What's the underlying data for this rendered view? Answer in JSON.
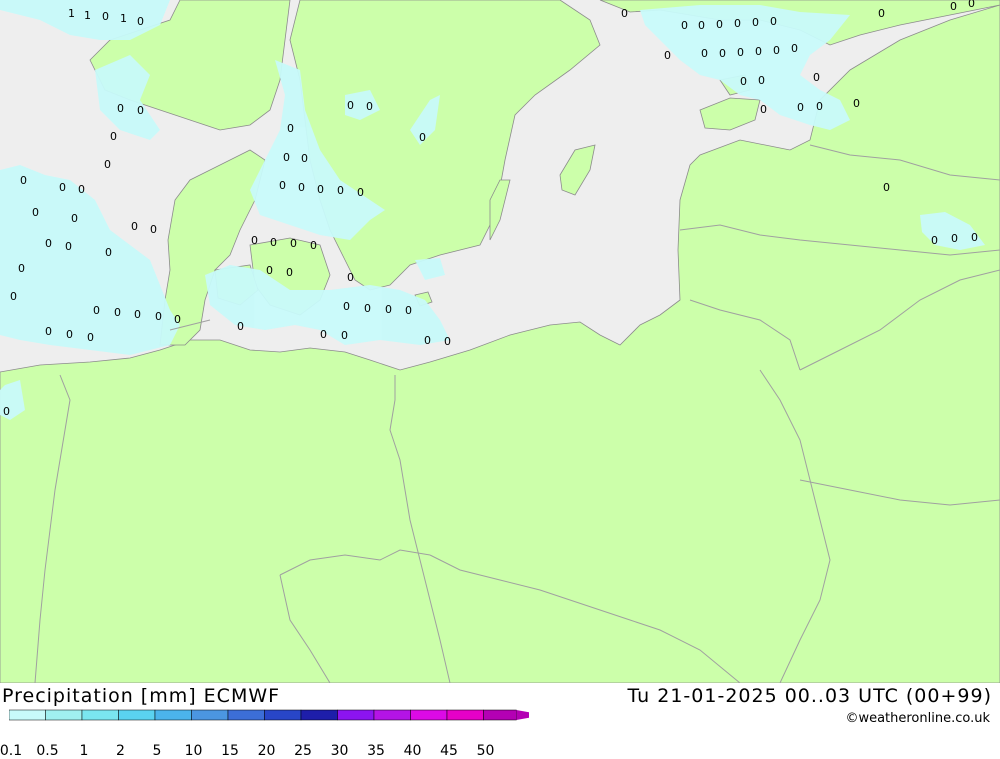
{
  "header": {
    "title_left": "Precipitation [mm] ECMWF",
    "title_right": "Tu 21-01-2025 00..03 UTC (00+99)",
    "credit": "©weatheronline.co.uk"
  },
  "legend": {
    "labels": [
      "0.1",
      "0.5",
      "1",
      "2",
      "5",
      "10",
      "15",
      "20",
      "25",
      "30",
      "35",
      "40",
      "45",
      "50"
    ],
    "colors": [
      "#c8fafa",
      "#a0f0f0",
      "#7ae6f0",
      "#5ad2f0",
      "#4bb4eb",
      "#4b96e1",
      "#3c6ed7",
      "#2846c8",
      "#1e1eaa",
      "#8c14f0",
      "#b414e6",
      "#dc0ae6",
      "#e600c8",
      "#b400b4"
    ]
  },
  "colors": {
    "sea": "#eeeeee",
    "land": "#ccff aa",
    "precip_light": "#c8fafa",
    "border": "#a0a0a0"
  },
  "precip_labels": [
    "1",
    "0"
  ]
}
